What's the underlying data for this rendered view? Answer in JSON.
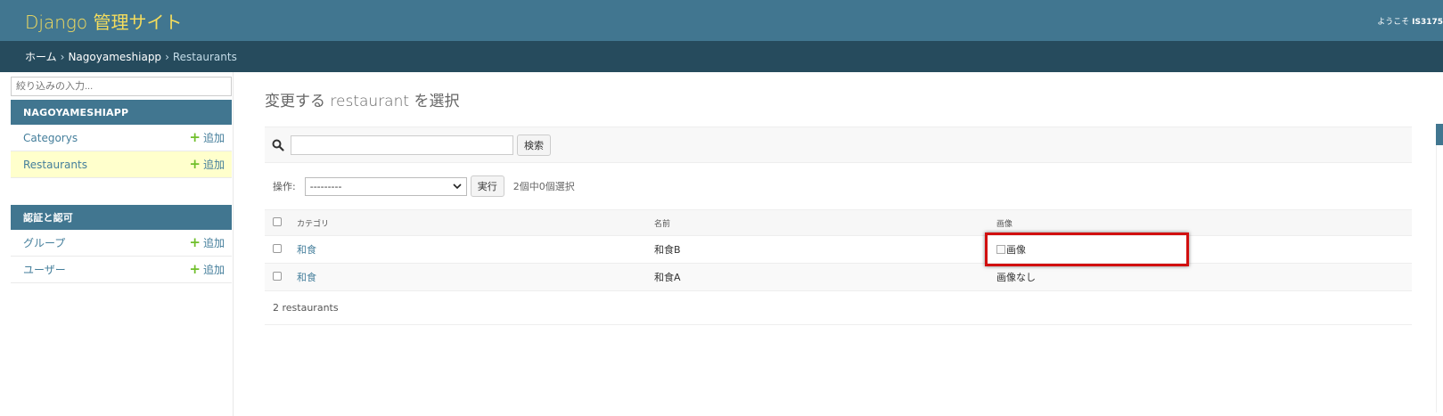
{
  "header": {
    "site_name": "Django 管理サイト",
    "welcome": "ようこそ ",
    "username": "IS3175"
  },
  "breadcrumbs": {
    "home": "ホーム",
    "app": "Nagoyameshiapp",
    "current": "Restaurants",
    "sep": "›"
  },
  "sidebar": {
    "filter_placeholder": "絞り込みの入力...",
    "modules": [
      {
        "caption": "NAGOYAMESHIAPP",
        "models": [
          {
            "name": "Categorys",
            "add": "追加"
          },
          {
            "name": "Restaurants",
            "add": "追加"
          }
        ]
      },
      {
        "caption": "認証と認可",
        "models": [
          {
            "name": "グループ",
            "add": "追加"
          },
          {
            "name": "ユーザー",
            "add": "追加"
          }
        ]
      }
    ]
  },
  "content": {
    "title": "変更する restaurant を選択",
    "search_button": "検索",
    "search_value": "",
    "action_label": "操作:",
    "action_selected": "---------",
    "go_button": "実行",
    "action_counter": "2個中0個選択",
    "columns": [
      "カテゴリ",
      "名前",
      "画像"
    ],
    "rows": [
      {
        "category": "和食",
        "name": "和食B",
        "image": "画像",
        "image_broken": true
      },
      {
        "category": "和食",
        "name": "和食A",
        "image": "画像なし",
        "image_broken": false
      }
    ],
    "paginator": "2 restaurants"
  },
  "colors": {
    "header": "#417690",
    "breadcrumbs": "#264b5d",
    "site_name": "#f5dd5d",
    "link": "#447e9b",
    "add_plus": "#70bf2b",
    "highlight": "#d10f0f"
  }
}
